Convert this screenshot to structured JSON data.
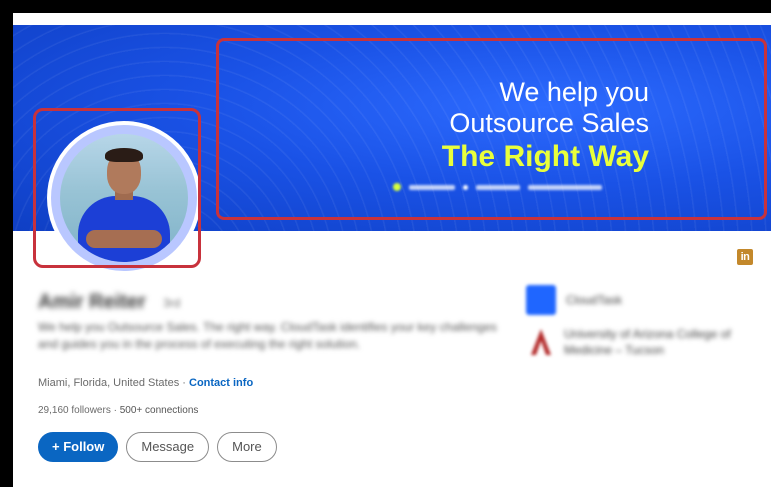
{
  "banner": {
    "line1": "We help you",
    "line2": "Outsource Sales",
    "line3": "The Right Way",
    "colors": {
      "background": "#1a52e6",
      "accent": "#e9ff3b",
      "text": "#ffffff"
    }
  },
  "profile": {
    "name": "Amir Reiter",
    "pronoun": "3rd",
    "headline": "We help you Outsource Sales. The right way. CloudTask identifies your key challenges and guides you in the process of executing the right solution.",
    "location": "Miami, Florida, United States",
    "separator": " · ",
    "contact_info": "Contact info",
    "followers": "29,160 followers",
    "connections": "500+ connections"
  },
  "actions": {
    "follow": "+ Follow",
    "message": "Message",
    "more": "More"
  },
  "sidebar": {
    "company": "CloudTask",
    "education": "University of Arizona College of Medicine – Tucson"
  },
  "badge": {
    "linkedin": "in"
  },
  "colors": {
    "brand": "#0a66c2",
    "highlight": "#c8323c"
  }
}
